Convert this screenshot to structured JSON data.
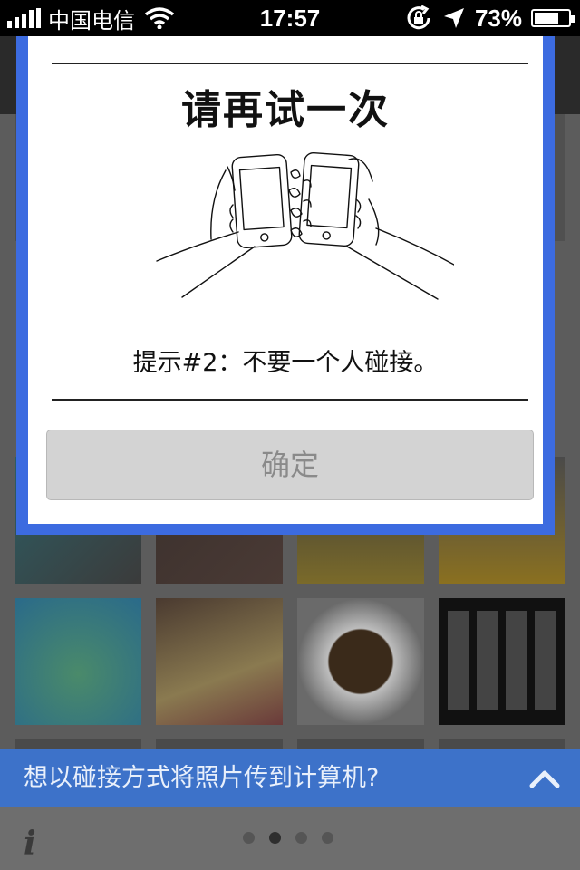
{
  "status_bar": {
    "carrier": "中国电信",
    "time": "17:57",
    "battery_percent": "73%",
    "battery_level": 0.73
  },
  "dialog": {
    "title": "请再试一次",
    "hint": "提示#2：不要一个人碰接。",
    "ok_label": "确定"
  },
  "bottom_banner": {
    "prompt": "想以碰接方式将照片传到计算机?"
  },
  "pagination": {
    "total": 4,
    "current": 2
  },
  "colors": {
    "dialog_frame": "#3c6be0",
    "banner": "#3d72c9",
    "button_bg": "#d3d3d3",
    "button_text": "#8a8a8a"
  },
  "icons": [
    "signal-icon",
    "wifi-icon",
    "rotation-lock-icon",
    "location-icon",
    "battery-icon",
    "chevron-up-icon",
    "info-icon"
  ]
}
